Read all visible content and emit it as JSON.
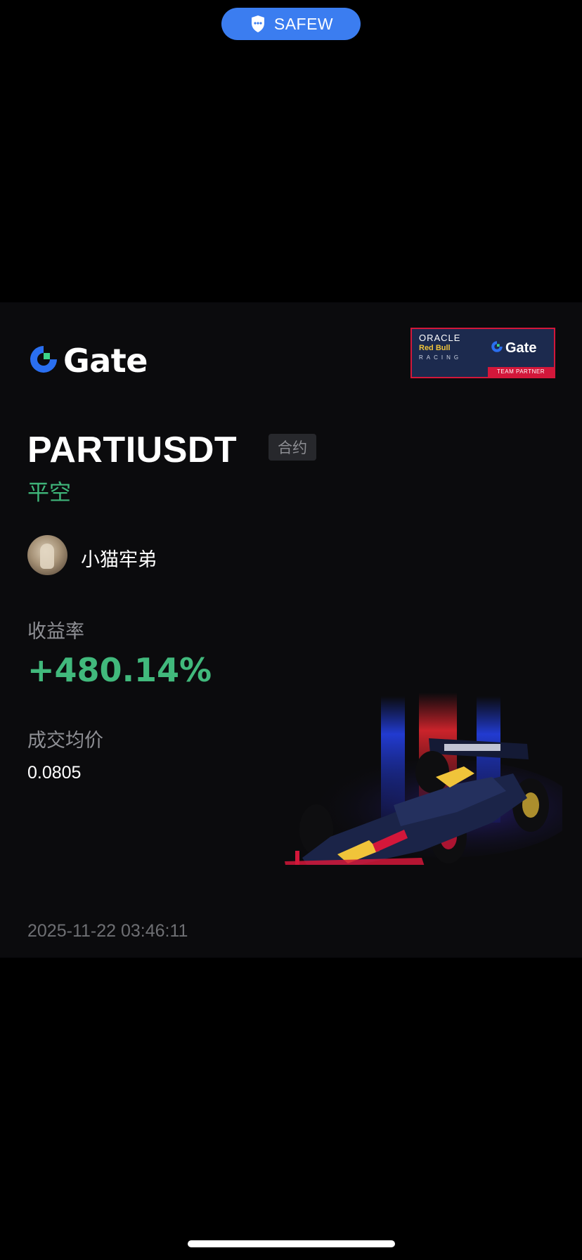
{
  "top_pill": {
    "label": "SAFEW",
    "icon": "chat-shield-icon",
    "color": "#3b7df0"
  },
  "card": {
    "brand": "Gate",
    "partner_badge": {
      "line1": "ORACLE",
      "line2": "Red Bull",
      "line3": "RACING",
      "brand": "Gate",
      "strip": "TEAM PARTNER"
    },
    "symbol": "PARTIUSDT",
    "contract_tag": "合约",
    "direction": "平空",
    "username": "小猫牢弟",
    "roi_label": "收益率",
    "roi_value": "+480.14%",
    "avg_price_label": "成交均价",
    "avg_price_value": "0.0805",
    "timestamp": "2025-11-22 03:46:11",
    "colors": {
      "profit_green": "#41b97c",
      "background": "#0b0b0d",
      "gate_blue": "#2a6ff0",
      "gate_green": "#3cd488"
    }
  }
}
